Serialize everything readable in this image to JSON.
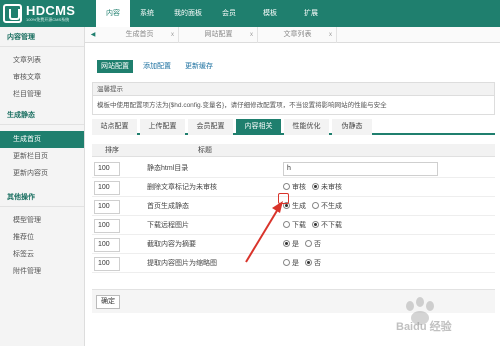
{
  "app": {
    "logo_text": "HDCMS",
    "logo_sub": "100%免费开源CMS系统"
  },
  "topnav": [
    {
      "label": "内容",
      "active": true
    },
    {
      "label": "系统"
    },
    {
      "label": "我的面板"
    },
    {
      "label": "会员"
    },
    {
      "label": "模板"
    },
    {
      "label": "扩展"
    }
  ],
  "sidebar": {
    "groups": [
      {
        "title": "内容管理",
        "items": [
          "文章列表",
          "审核文章",
          "栏目管理"
        ]
      },
      {
        "title": "生成静态",
        "items": [
          "生成首页",
          "更新栏目页",
          "更新内容页"
        ]
      },
      {
        "title": "其他操作",
        "items": [
          "模型管理",
          "推荐位",
          "标签云",
          "附件管理"
        ]
      }
    ]
  },
  "tabs": {
    "prev_arrow": "◀",
    "items": [
      {
        "label": "生成首页",
        "close": "x"
      },
      {
        "label": "网站配置",
        "close": "x"
      },
      {
        "label": "文章列表",
        "close": "x"
      }
    ]
  },
  "subnav": [
    {
      "label": "网站配置",
      "active": true
    },
    {
      "label": "添加配置"
    },
    {
      "label": "更新缓存"
    }
  ],
  "tip": {
    "title": "温馨提示",
    "text": "模板中使用配置项方法为{$hd.config.变量名}，请仔细修改配置项，不当设置将影响网站的性能与安全"
  },
  "config_tabs": [
    {
      "label": "站点配置"
    },
    {
      "label": "上传配置"
    },
    {
      "label": "会员配置"
    },
    {
      "label": "内容相关",
      "active": true
    },
    {
      "label": "性能优化"
    },
    {
      "label": "伪静态"
    }
  ],
  "grid": {
    "head_sort": "排序",
    "head_title": "标题",
    "rows": [
      {
        "sort": "100",
        "label": "静态html目录",
        "input": "h"
      },
      {
        "sort": "100",
        "label": "删除文章标记为未审核",
        "opt1": "审核",
        "opt2": "未审核"
      },
      {
        "sort": "100",
        "label": "首页生成静态",
        "opt1": "生成",
        "opt2": "不生成"
      },
      {
        "sort": "100",
        "label": "下载远程图片",
        "opt1": "下载",
        "opt2": "不下载"
      },
      {
        "sort": "100",
        "label": "截取内容为摘要",
        "opt1": "是",
        "opt2": "否"
      },
      {
        "sort": "100",
        "label": "提取内容图片为缩略图",
        "opt1": "是",
        "opt2": "否"
      }
    ]
  },
  "footer": {
    "confirm": "确定"
  },
  "watermark": {
    "text": "Baidu 经验"
  },
  "colors": {
    "primary": "#1f7f6e",
    "annotation": "#d9342b"
  }
}
